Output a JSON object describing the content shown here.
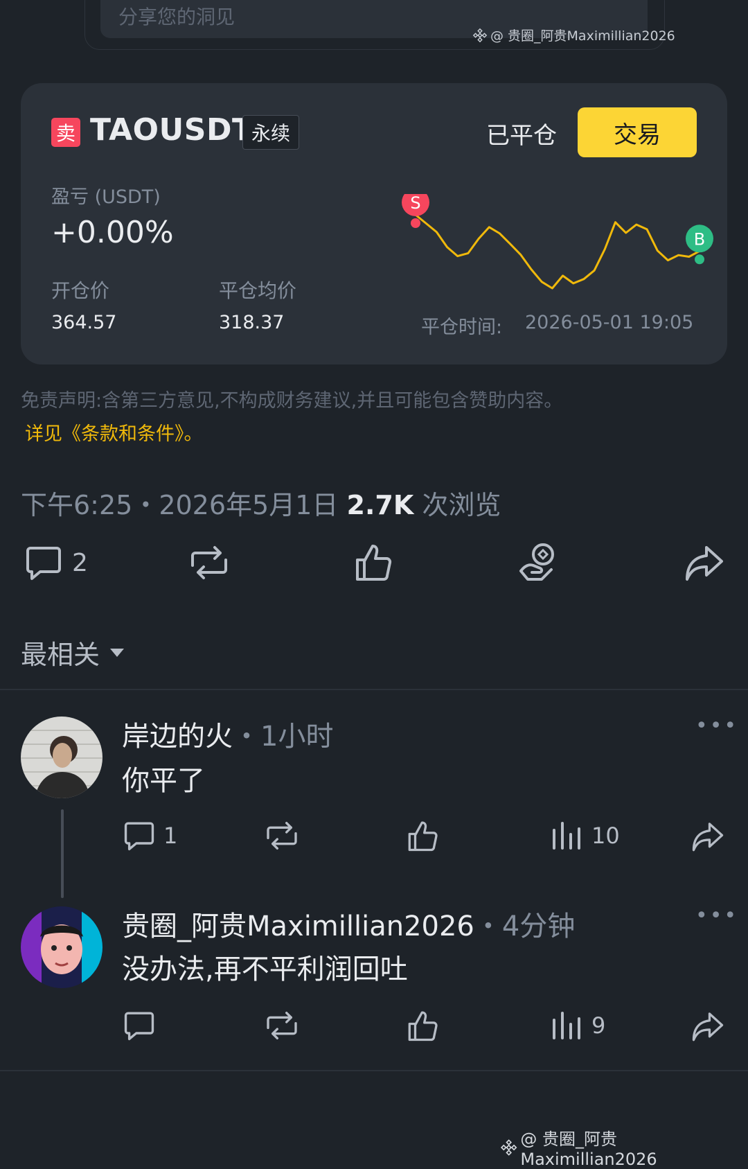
{
  "share": {
    "placeholder": "分享您的洞见"
  },
  "watermark": {
    "text": "@ 贵圈_阿贵Maximillian2026"
  },
  "trade_card": {
    "side_badge": "卖",
    "symbol": "TAOUSDT",
    "contract_type": "永续",
    "status": "已平仓",
    "trade_button": "交易",
    "pnl_label": "盈亏 (USDT)",
    "pnl_value": "+0.00%",
    "open_price_label": "开仓价",
    "open_price": "364.57",
    "close_price_label": "平仓均价",
    "close_price": "318.37",
    "close_time_label": "平仓时间:",
    "close_time": "2026-05-01 19:05",
    "entry_marker": "S",
    "exit_marker": "B",
    "colors": {
      "sell": "#f6465d",
      "buy": "#2ebd85",
      "line": "#f0b90b"
    }
  },
  "chart_data": {
    "type": "line",
    "series": [
      {
        "values": [
          364.6,
          360.2,
          355.8,
          348.1,
          343.5,
          345.0,
          352.4,
          358.3,
          355.1,
          349.7,
          344.2,
          336.8,
          330.4,
          327.1,
          333.5,
          329.6,
          331.8,
          336.2,
          347.1,
          360.8,
          355.4,
          359.6,
          357.2,
          346.3,
          341.4,
          344.0,
          343.2,
          346.1
        ]
      }
    ]
  },
  "disclaimer": {
    "text": "免责声明:含第三方意见,不构成财务建议,并且可能包含赞助内容。",
    "link": "详见《条款和条件》。"
  },
  "post_meta": {
    "time": "下午6:25・2026年5月1日",
    "views_count": "2.7K",
    "views_label": "次浏览"
  },
  "post_actions": {
    "comment_count": "2"
  },
  "sort": {
    "label": "最相关"
  },
  "comments": [
    {
      "name": "岸边的火",
      "time": "・1小时",
      "text": "你平了",
      "reply_count": "1",
      "views": "10"
    },
    {
      "name": "贵圈_阿贵Maximillian2026",
      "time": "・4分钟",
      "text": "没办法,再不平利润回吐",
      "reply_count": "",
      "views": "9"
    }
  ]
}
